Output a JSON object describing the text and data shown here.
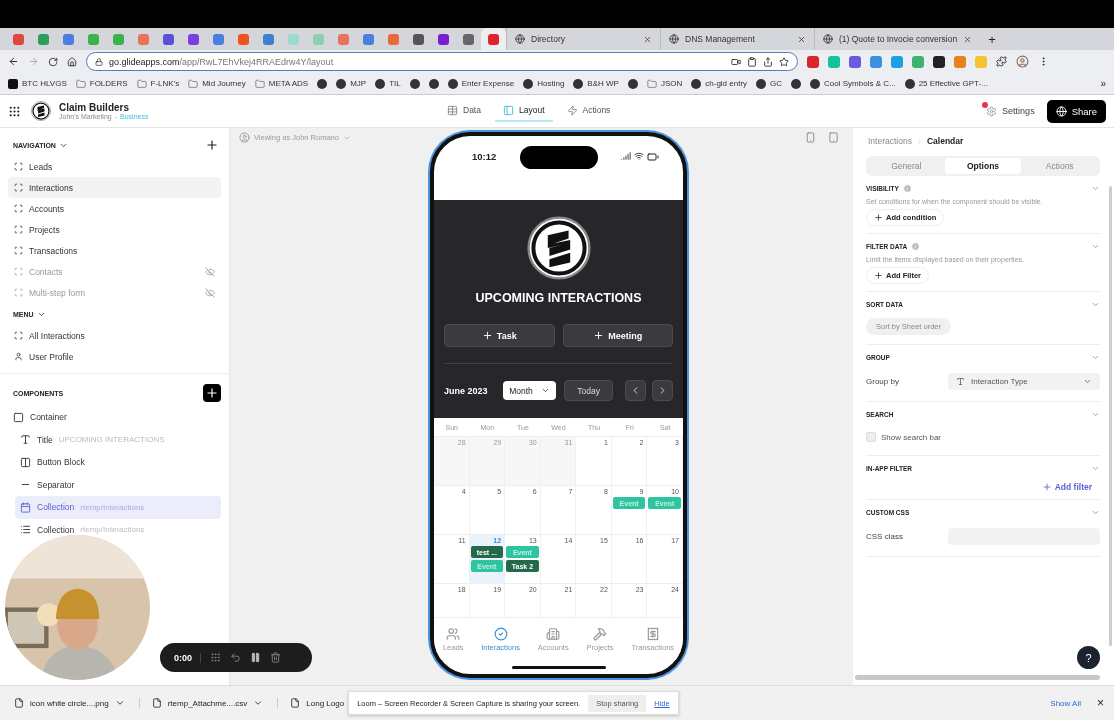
{
  "browser": {
    "pinned_tabs": [
      {
        "color": "#e0463e",
        "selected": false
      },
      {
        "color": "#2f9e5a",
        "selected": false
      },
      {
        "color": "#4a7fe0",
        "selected": false
      },
      {
        "color": "#3cb34a",
        "selected": false
      },
      {
        "color": "#3cb34a",
        "selected": false
      },
      {
        "color": "#e9735a",
        "selected": false
      },
      {
        "color": "#5a4fd8",
        "selected": false
      },
      {
        "color": "#7a3fe0",
        "selected": false
      },
      {
        "color": "#4a7fe0",
        "selected": false
      },
      {
        "color": "#f0541e",
        "selected": false
      },
      {
        "color": "#3f7fd0",
        "selected": false
      },
      {
        "color": "#9adbd0",
        "selected": false
      },
      {
        "color": "#8fcfb0",
        "selected": false
      },
      {
        "color": "#e9735a",
        "selected": false
      },
      {
        "color": "#4a7fe0",
        "selected": false
      },
      {
        "color": "#e86a3a",
        "selected": false
      },
      {
        "color": "#555555",
        "selected": false
      },
      {
        "color": "#7a1fd0",
        "selected": false
      },
      {
        "color": "#666666",
        "selected": false
      },
      {
        "color": "#e0242c",
        "selected": true
      }
    ],
    "tabs": [
      {
        "title": "Directory"
      },
      {
        "title": "DNS Management"
      },
      {
        "title": "(1) Quote to Invocie conversion"
      }
    ],
    "new_tab": "+",
    "url_host": "go.glideapps.com",
    "url_path": "/app/RwL7EhVkej4RRAEdrw4Y/layout",
    "extensions": [
      {
        "color": "#d9262c"
      },
      {
        "color": "#15c39a"
      },
      {
        "color": "#6a5ae0"
      },
      {
        "color": "#3f8fe0"
      },
      {
        "color": "#1ba1e2"
      },
      {
        "color": "#3cb371"
      },
      {
        "color": "#222222"
      },
      {
        "color": "#e8821e"
      },
      {
        "color": "#f4c430"
      }
    ],
    "bookmarks": [
      {
        "kind": "brand",
        "label": "BTC HLVGS"
      },
      {
        "kind": "folder",
        "label": "FOLDERS"
      },
      {
        "kind": "folder",
        "label": "F-LNK's"
      },
      {
        "kind": "folder",
        "label": "Mid Journey"
      },
      {
        "kind": "folder",
        "label": "META ADS"
      },
      {
        "kind": "site"
      },
      {
        "kind": "site",
        "label": "MJP"
      },
      {
        "kind": "site",
        "label": "TIL"
      },
      {
        "kind": "site"
      },
      {
        "kind": "site"
      },
      {
        "kind": "site",
        "label": "Enter Expense"
      },
      {
        "kind": "site",
        "label": "Hosting"
      },
      {
        "kind": "site",
        "label": "B&H WP"
      },
      {
        "kind": "site"
      },
      {
        "kind": "folder",
        "label": "JSON"
      },
      {
        "kind": "site",
        "label": "ch-gld entry"
      },
      {
        "kind": "site",
        "label": "GC"
      },
      {
        "kind": "site"
      },
      {
        "kind": "site",
        "label": "Cool Symbols & C..."
      },
      {
        "kind": "site",
        "label": "25 Effective GPT-..."
      }
    ],
    "bookmarks_more": "»"
  },
  "app": {
    "name": "Claim Builders",
    "team": "John's Marketing",
    "separator": "-",
    "plan": "Business",
    "modes": [
      {
        "label": "Data",
        "kind": "data",
        "selected": false
      },
      {
        "label": "Layout",
        "kind": "layout",
        "selected": true
      },
      {
        "label": "Actions",
        "kind": "actions",
        "selected": false
      }
    ],
    "settings": "Settings",
    "settings_notice": true,
    "share": "Share"
  },
  "sidebar": {
    "navigation_title": "NAVIGATION",
    "navigation": [
      {
        "label": "Leads",
        "selected": false,
        "hidden": false
      },
      {
        "label": "Interactions",
        "selected": true,
        "hidden": false
      },
      {
        "label": "Accounts",
        "selected": false,
        "hidden": false
      },
      {
        "label": "Projects",
        "selected": false,
        "hidden": false
      },
      {
        "label": "Transactions",
        "selected": false,
        "hidden": false
      },
      {
        "label": "Contacts",
        "selected": false,
        "hidden": true
      },
      {
        "label": "Multi-step form",
        "selected": false,
        "hidden": true
      }
    ],
    "menu_title": "MENU",
    "menu": [
      {
        "label": "All Interactions",
        "kind": "screen"
      },
      {
        "label": "User Profile",
        "kind": "profile"
      }
    ],
    "components_title": "COMPONENTS",
    "components": [
      {
        "label": "Container",
        "kind": "container",
        "selected": false,
        "children": [
          {
            "label": "Title",
            "detail": "UPCOMING INTERACTIONS",
            "kind": "title",
            "selected": false
          },
          {
            "label": "Button Block",
            "kind": "buttons",
            "selected": false
          },
          {
            "label": "Separator",
            "kind": "separator",
            "selected": false
          },
          {
            "label": "Collection",
            "detail": "rtemp/Interactions",
            "kind": "calendar",
            "selected": true
          },
          {
            "label": "Collection",
            "detail": "rtemp/Interactions",
            "kind": "list",
            "selected": false
          }
        ]
      }
    ]
  },
  "canvas": {
    "viewing_as": "Viewing as John Romano",
    "phone": {
      "time": "10:12",
      "title": "UPCOMING INTERACTIONS",
      "buttons": [
        "Task",
        "Meeting"
      ],
      "month": "June 2023",
      "view": "Month",
      "today": "Today",
      "weekdays": [
        "Sun",
        "Mon",
        "Tue",
        "Wed",
        "Thu",
        "Fri",
        "Sat"
      ],
      "weeks": [
        [
          {
            "day": "28",
            "muted": true,
            "today": false
          },
          {
            "day": "29",
            "muted": true,
            "today": false
          },
          {
            "day": "30",
            "muted": true,
            "today": false
          },
          {
            "day": "31",
            "muted": true,
            "today": false
          },
          {
            "day": "1",
            "muted": false,
            "today": false
          },
          {
            "day": "2",
            "muted": false,
            "today": false
          },
          {
            "day": "3",
            "muted": false,
            "today": false
          }
        ],
        [
          {
            "day": "4",
            "muted": false,
            "today": false
          },
          {
            "day": "5",
            "muted": false,
            "today": false
          },
          {
            "day": "6",
            "muted": false,
            "today": false
          },
          {
            "day": "7",
            "muted": false,
            "today": false
          },
          {
            "day": "8",
            "muted": false,
            "today": false
          },
          {
            "day": "9",
            "muted": false,
            "today": false,
            "events": [
              {
                "label": "Event",
                "color": "#2ec4a0"
              }
            ]
          },
          {
            "day": "10",
            "muted": false,
            "today": false,
            "events": [
              {
                "label": "Event",
                "color": "#2ec4a0"
              }
            ]
          }
        ],
        [
          {
            "day": "11",
            "muted": false,
            "today": false
          },
          {
            "day": "12",
            "muted": false,
            "today": true,
            "events": [
              {
                "label": "test ...",
                "color": "#23694a"
              },
              {
                "label": "Event",
                "color": "#2ec4a0"
              }
            ]
          },
          {
            "day": "13",
            "muted": false,
            "today": false,
            "events": [
              {
                "label": "Event",
                "color": "#2ec4a0"
              },
              {
                "label": "Task 2",
                "color": "#23694a"
              }
            ]
          },
          {
            "day": "14",
            "muted": false,
            "today": false
          },
          {
            "day": "15",
            "muted": false,
            "today": false
          },
          {
            "day": "16",
            "muted": false,
            "today": false
          },
          {
            "day": "17",
            "muted": false,
            "today": false
          }
        ],
        [
          {
            "day": "18",
            "muted": false,
            "today": false
          },
          {
            "day": "19",
            "muted": false,
            "today": false
          },
          {
            "day": "20",
            "muted": false,
            "today": false
          },
          {
            "day": "21",
            "muted": false,
            "today": false
          },
          {
            "day": "22",
            "muted": false,
            "today": false
          },
          {
            "day": "23",
            "muted": false,
            "today": false
          },
          {
            "day": "24",
            "muted": false,
            "today": false
          }
        ]
      ],
      "tabs": [
        {
          "label": "Leads",
          "kind": "users",
          "selected": false
        },
        {
          "label": "Interactions",
          "kind": "check",
          "selected": true
        },
        {
          "label": "Accounts",
          "kind": "building",
          "selected": false
        },
        {
          "label": "Projects",
          "kind": "hammer",
          "selected": false
        },
        {
          "label": "Transactions",
          "kind": "receipt",
          "selected": false
        }
      ]
    },
    "recorder": {
      "time": "0:00"
    }
  },
  "panel": {
    "breadcrumb": [
      "Interactions",
      "Calendar"
    ],
    "tabs": [
      {
        "label": "General",
        "selected": false
      },
      {
        "label": "Options",
        "selected": true
      },
      {
        "label": "Actions",
        "selected": false
      }
    ],
    "sections": [
      {
        "title": "VISIBILITY",
        "info": true,
        "description": "Set conditions for when the component should be visible.",
        "control": {
          "kind": "add",
          "label": "Add condition"
        }
      },
      {
        "title": "FILTER DATA",
        "info": true,
        "description": "Limit the items displayed based on their properties.",
        "control": {
          "kind": "add",
          "label": "Add Filter"
        }
      },
      {
        "title": "SORT DATA",
        "info": false,
        "control": {
          "kind": "pill",
          "label": "Sort by Sheet order"
        }
      },
      {
        "title": "GROUP",
        "info": false,
        "control": {
          "kind": "select",
          "label": "Group by",
          "value": "Interaction Type"
        }
      },
      {
        "title": "SEARCH",
        "info": false,
        "control": {
          "kind": "checkbox",
          "label": "Show search bar",
          "checked": false
        }
      },
      {
        "title": "IN-APP FILTER",
        "info": false,
        "control": {
          "kind": "link",
          "label": "Add filter"
        }
      },
      {
        "title": "CUSTOM CSS",
        "info": false,
        "control": {
          "kind": "input",
          "label": "CSS class"
        }
      }
    ]
  },
  "downloads": {
    "items": [
      "icon white circle....png",
      "rtemp_Attachme....csv",
      "Long Logo"
    ],
    "show_all": "Show All",
    "close": "×"
  },
  "loom": {
    "message": "Loom – Screen Recorder & Screen Capture is sharing your screen.",
    "stop": "Stop sharing",
    "hide": "Hide"
  },
  "help": "?"
}
